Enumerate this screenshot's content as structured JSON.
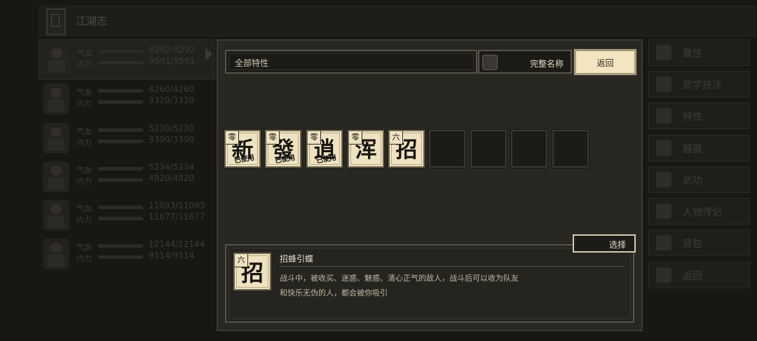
{
  "header": {
    "title": "江湖志"
  },
  "characters": [
    {
      "qi_label": "气血",
      "nei_label": "内力",
      "qi_value": "8292/8292",
      "nei_value": "9591/9591",
      "active": true
    },
    {
      "qi_label": "气血",
      "nei_label": "内力",
      "qi_value": "4260/4260",
      "nei_value": "3320/3320",
      "active": false
    },
    {
      "qi_label": "气血",
      "nei_label": "内力",
      "qi_value": "5230/5230",
      "nei_value": "3390/3390",
      "active": false
    },
    {
      "qi_label": "气血",
      "nei_label": "内力",
      "qi_value": "5234/5234",
      "nei_value": "4820/4820",
      "active": false
    },
    {
      "qi_label": "气血",
      "nei_label": "内力",
      "qi_value": "11093/11093",
      "nei_value": "11677/11677",
      "active": false
    },
    {
      "qi_label": "气血",
      "nei_label": "内力",
      "qi_value": "12144/12144",
      "nei_value": "9114/9114",
      "active": false
    }
  ],
  "right_menu": [
    "属性",
    "武学技法",
    "特性",
    "器器",
    "武功",
    "人物传记",
    "背包",
    "返回"
  ],
  "filter": {
    "text": "全部特性",
    "fullname_label": "完整名称",
    "back_label": "返回"
  },
  "traits": [
    {
      "glyph": "新",
      "grade": "零",
      "used": "已使用"
    },
    {
      "glyph": "發",
      "grade": "零",
      "used": "已使用"
    },
    {
      "glyph": "逍",
      "grade": "零",
      "used": "已使用"
    },
    {
      "glyph": "浑",
      "grade": "零",
      "used": ""
    },
    {
      "glyph": "招",
      "grade": "六",
      "used": ""
    }
  ],
  "empty_slots": 4,
  "detail": {
    "select_label": "选择",
    "glyph": "招",
    "grade": "六",
    "name": "招蜂引蝶",
    "description_line1": "战斗中，被收买、迷惑、魅惑、清心正气的敌人，战斗后可以收为队友",
    "description_line2": "和快乐无伪的人，都会被你吸引"
  },
  "colors": {
    "accent_tile": "#efe2c0",
    "panel": "#282722",
    "background": "#151411"
  }
}
